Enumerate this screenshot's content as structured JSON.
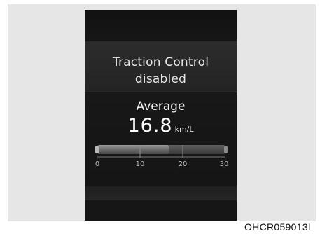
{
  "message": {
    "line1": "Traction Control",
    "line2": "disabled"
  },
  "fuel_economy": {
    "title": "Average",
    "value": "16.8",
    "unit": "km/L"
  },
  "gauge": {
    "ticks": [
      "0",
      "10",
      "20",
      "30"
    ],
    "fill_fraction": 0.56
  },
  "figure_code": "OHCR059013L"
}
